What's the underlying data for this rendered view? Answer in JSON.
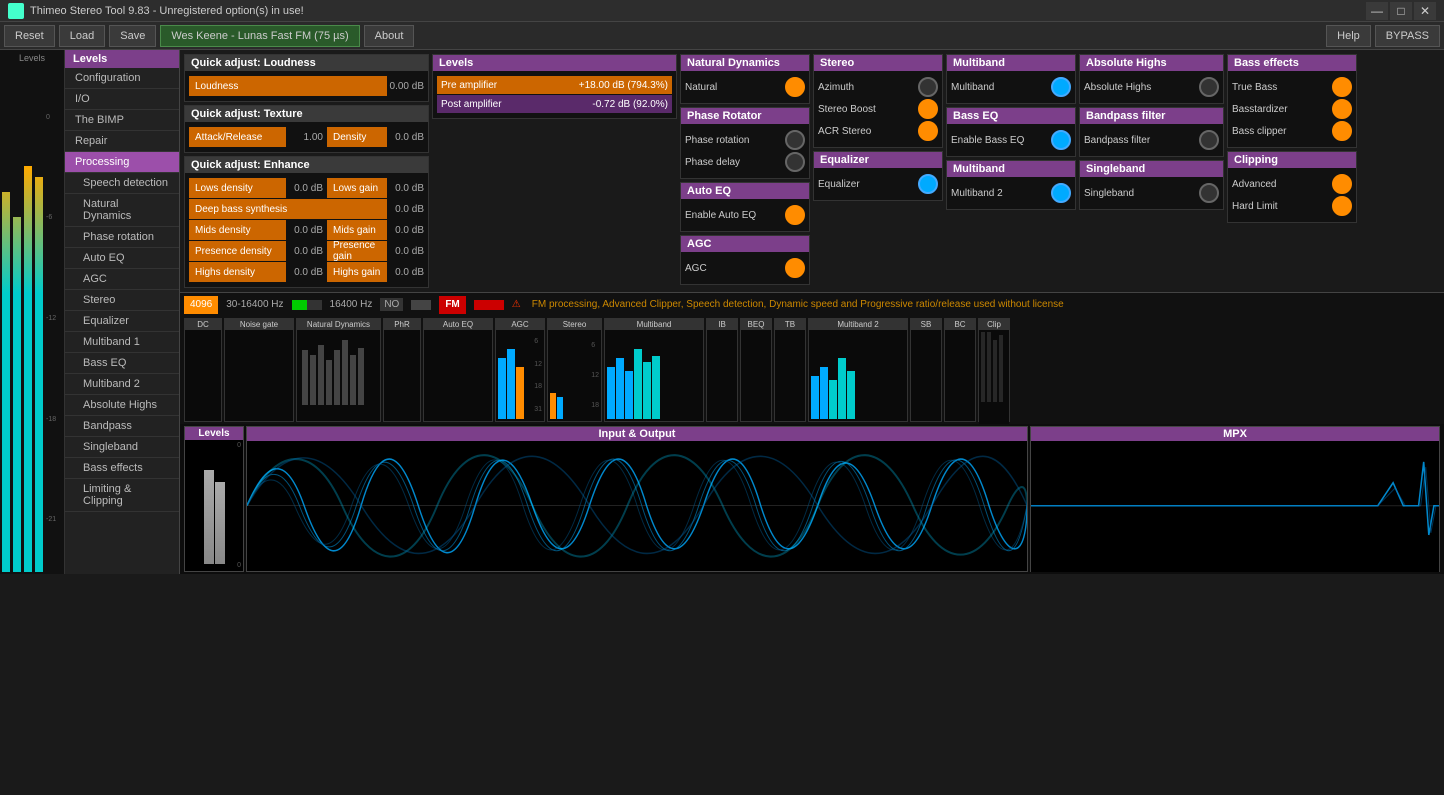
{
  "titlebar": {
    "title": "Thimeo Stereo Tool 9.83 - Unregistered option(s) in use!",
    "icon": "app-icon"
  },
  "toolbar": {
    "reset": "Reset",
    "load": "Load",
    "save": "Save",
    "preset": "Wes Keene - Lunas Fast FM (75 µs)",
    "about": "About",
    "help": "Help",
    "bypass": "BYPASS"
  },
  "sidebar": {
    "header": "Levels",
    "items": [
      {
        "label": "Configuration",
        "active": false,
        "sub": false
      },
      {
        "label": "I/O",
        "active": false,
        "sub": false
      },
      {
        "label": "The BIMP",
        "active": false,
        "sub": false
      },
      {
        "label": "Repair",
        "active": false,
        "sub": false
      },
      {
        "label": "Processing",
        "active": true,
        "sub": false
      },
      {
        "label": "Speech detection",
        "active": false,
        "sub": true
      },
      {
        "label": "Natural Dynamics",
        "active": false,
        "sub": true
      },
      {
        "label": "Phase rotation",
        "active": false,
        "sub": true
      },
      {
        "label": "Auto EQ",
        "active": false,
        "sub": true
      },
      {
        "label": "AGC",
        "active": false,
        "sub": true
      },
      {
        "label": "Stereo",
        "active": false,
        "sub": true
      },
      {
        "label": "Equalizer",
        "active": false,
        "sub": true
      },
      {
        "label": "Multiband 1",
        "active": false,
        "sub": true
      },
      {
        "label": "Bass EQ",
        "active": false,
        "sub": true
      },
      {
        "label": "Multiband 2",
        "active": false,
        "sub": true
      },
      {
        "label": "Absolute Highs",
        "active": false,
        "sub": true
      },
      {
        "label": "Bandpass",
        "active": false,
        "sub": true
      },
      {
        "label": "Singleband",
        "active": false,
        "sub": true
      },
      {
        "label": "Bass effects",
        "active": false,
        "sub": true
      },
      {
        "label": "Limiting & Clipping",
        "active": false,
        "sub": true
      }
    ]
  },
  "quick_loudness": {
    "title": "Quick adjust: Loudness",
    "loudness_label": "Loudness",
    "loudness_value": "0.00 dB"
  },
  "quick_texture": {
    "title": "Quick adjust: Texture",
    "attack_label": "Attack/Release",
    "attack_value": "1.00",
    "density_label": "Density",
    "density_value": "0.0 dB"
  },
  "quick_enhance": {
    "title": "Quick adjust: Enhance",
    "rows": [
      {
        "label": "Lows density",
        "val1": "0.0 dB",
        "label2": "Lows gain",
        "val2": "0.0 dB"
      },
      {
        "label": "Deep bass synthesis",
        "val1": "0.0 dB"
      },
      {
        "label": "Mids density",
        "val1": "0.0 dB",
        "label2": "Mids gain",
        "val2": "0.0 dB"
      },
      {
        "label": "Presence density",
        "val1": "0.0 dB",
        "label2": "Presence gain",
        "val2": "0.0 dB"
      },
      {
        "label": "Highs density",
        "val1": "0.0 dB",
        "label2": "Highs gain",
        "val2": "0.0 dB"
      }
    ]
  },
  "levels_panel": {
    "title": "Levels",
    "pre_label": "Pre amplifier",
    "pre_value": "+18.00 dB (794.3%)",
    "post_label": "Post amplifier",
    "post_value": "-0.72 dB (92.0%)"
  },
  "natural_dynamics": {
    "title": "Natural Dynamics",
    "natural_label": "Natural",
    "toggle_on": true
  },
  "phase_rotator": {
    "title": "Phase Rotator",
    "rotation_label": "Phase rotation",
    "delay_label": "Phase delay"
  },
  "auto_eq": {
    "title": "Auto EQ",
    "enable_label": "Enable Auto EQ",
    "toggle_on": true
  },
  "agc": {
    "title": "AGC",
    "label": "AGC",
    "toggle_on": true
  },
  "stereo": {
    "title": "Stereo",
    "azimuth_label": "Azimuth",
    "stereo_boost_label": "Stereo Boost",
    "acr_label": "ACR Stereo"
  },
  "equalizer": {
    "title": "Equalizer",
    "label": "Equalizer",
    "toggle_on": false
  },
  "multiband": {
    "title": "Multiband",
    "label": "Multiband",
    "toggle_on": true
  },
  "multiband2": {
    "title": "Multiband",
    "label": "Multiband 2",
    "toggle_on": true
  },
  "absolute_highs": {
    "title": "Absolute Highs",
    "label": "Absolute Highs",
    "toggle_on": false
  },
  "bandpass": {
    "title": "Bandpass filter",
    "label": "Bandpass filter",
    "toggle_on": false
  },
  "singleband": {
    "title": "Singleband",
    "label": "Singleband",
    "toggle_on": false
  },
  "bass_eq": {
    "title": "Bass EQ",
    "label": "Enable Bass EQ",
    "toggle_on": true
  },
  "bass_effects": {
    "title": "Bass effects",
    "true_bass_label": "True Bass",
    "basstardizer_label": "Basstardizer",
    "bass_clipper_label": "Bass clipper"
  },
  "clipping": {
    "title": "Clipping",
    "advanced_label": "Advanced",
    "hardlimit_label": "Hard Limit",
    "toggle_on": true
  },
  "status_bar": {
    "samples": "4096",
    "freq_range": "30-16400 Hz",
    "freq_val": "16400 Hz",
    "mode_no": "NO",
    "mode_fm": "FM",
    "warning": "FM processing, Advanced Clipper, Speech detection, Dynamic speed and Progressive ratio/release used without license"
  },
  "strip_modules": [
    {
      "label": "DC",
      "type": "empty"
    },
    {
      "label": "Noise gate",
      "type": "bar"
    },
    {
      "label": "Natural Dynamics",
      "type": "wave"
    },
    {
      "label": "PhR",
      "type": "bar"
    },
    {
      "label": "Auto EQ",
      "type": "bar"
    },
    {
      "label": "AGC",
      "type": "meter"
    },
    {
      "label": "Stereo",
      "type": "stereo"
    },
    {
      "label": "Multiband",
      "type": "multiband"
    },
    {
      "label": "IB",
      "type": "small"
    },
    {
      "label": "BEQ",
      "type": "small"
    },
    {
      "label": "TB",
      "type": "small"
    },
    {
      "label": "Multiband 2",
      "type": "multiband2"
    },
    {
      "label": "SB",
      "type": "small"
    },
    {
      "label": "BC",
      "type": "small"
    },
    {
      "label": "Clip",
      "type": "small"
    }
  ],
  "bottom": {
    "input_output_title": "Input & Output",
    "mpx_title": "MPX",
    "levels_title": "Levels"
  }
}
